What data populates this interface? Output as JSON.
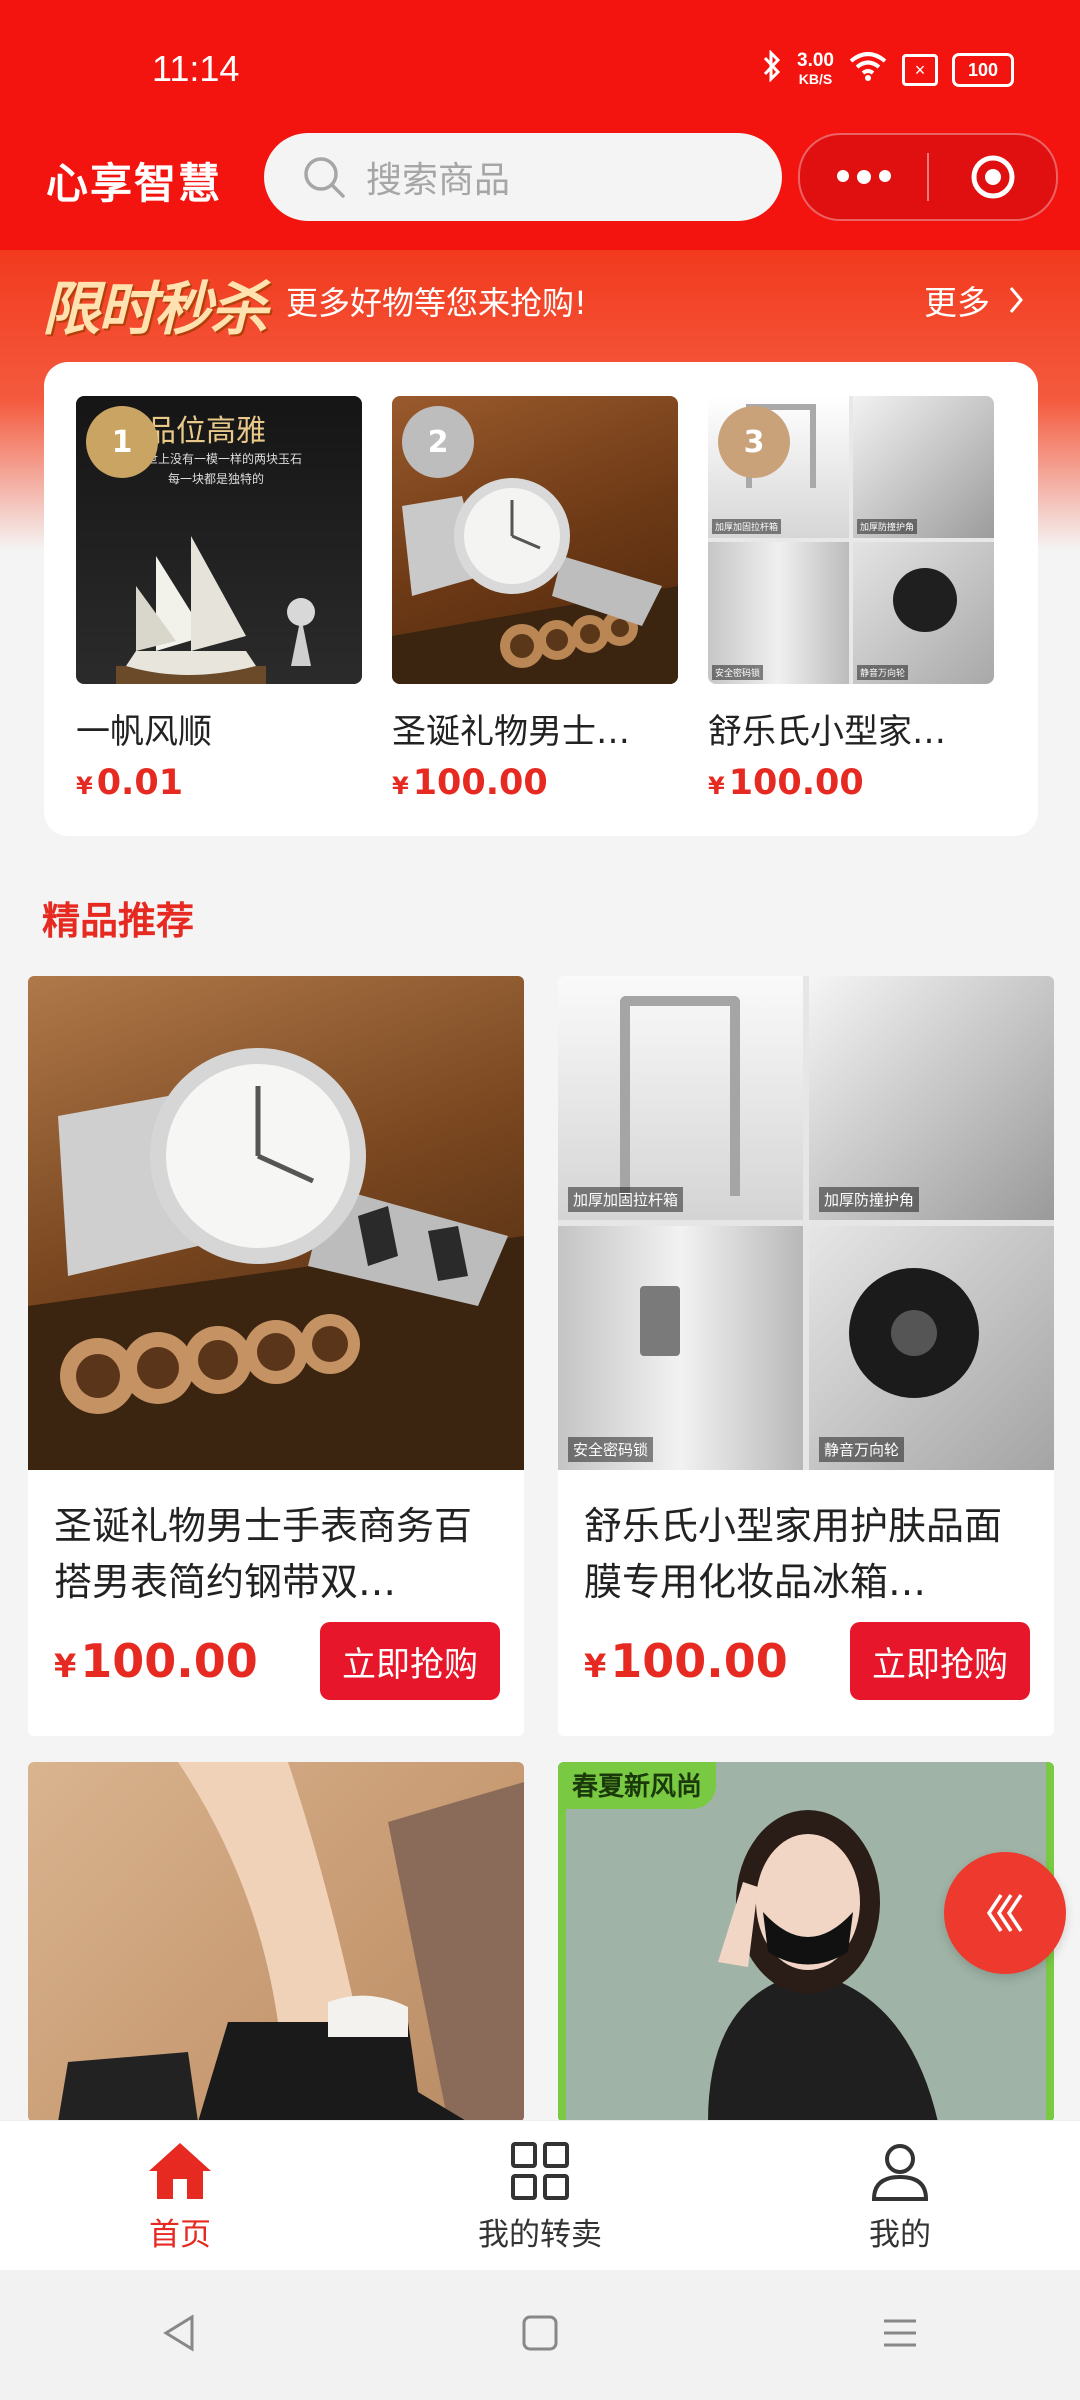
{
  "status": {
    "time": "11:14",
    "speed_value": "3.00",
    "speed_unit": "KB/S",
    "battery": "100"
  },
  "header": {
    "brand": "心享智慧",
    "search_placeholder": "搜索商品"
  },
  "flash": {
    "logo": "限时秒杀",
    "subtitle": "更多好物等您来抢购!",
    "more": "更多",
    "items": [
      {
        "rank": "1",
        "name": "一帆风顺",
        "currency": "¥",
        "price": "0.01",
        "image_text": "品位高雅",
        "image_caption1": "世上没有一模一样的两块玉石",
        "image_caption2": "每一块都是独特的"
      },
      {
        "rank": "2",
        "name": "圣诞礼物男士…",
        "currency": "¥",
        "price": "100.00"
      },
      {
        "rank": "3",
        "name": "舒乐氏小型家…",
        "currency": "¥",
        "price": "100.00",
        "image_labels": [
          "加厚加固拉杆箱",
          "加厚防撞护角",
          "安全密码锁",
          "静音万向轮"
        ]
      }
    ]
  },
  "section": {
    "title": "精品推荐"
  },
  "products": [
    {
      "title": "圣诞礼物男士手表商务百搭男表简约钢带双…",
      "currency": "¥",
      "price": "100.00",
      "button": "立即抢购"
    },
    {
      "title": "舒乐氏小型家用护肤品面膜专用化妆品冰箱…",
      "currency": "¥",
      "price": "100.00",
      "button": "立即抢购",
      "image_labels": [
        "加厚加固拉杆箱",
        "加厚防撞护角",
        "安全密码锁",
        "静音万向轮"
      ]
    },
    {
      "title": ""
    },
    {
      "title": "",
      "tag": "春夏新风尚"
    }
  ],
  "tabs": [
    {
      "label": "首页",
      "icon": "home-icon",
      "active": true
    },
    {
      "label": "我的转卖",
      "icon": "grid-icon",
      "active": false
    },
    {
      "label": "我的",
      "icon": "user-icon",
      "active": false
    }
  ],
  "colors": {
    "primary": "#f4140f",
    "price": "#e62a21",
    "button": "#e8162a"
  }
}
